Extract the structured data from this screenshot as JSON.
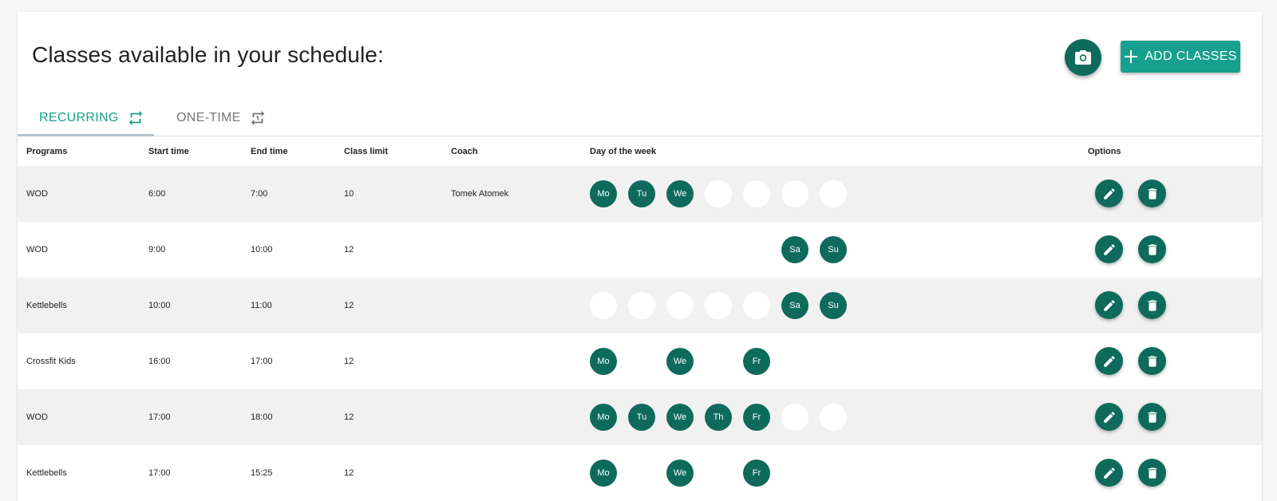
{
  "header": {
    "title": "Classes available in your schedule:",
    "camera_icon": "camera-icon",
    "add_label": "ADD CLASSES",
    "add_icon": "plus-icon"
  },
  "tabs": [
    {
      "label": "RECURRING",
      "icon": "repeat-icon",
      "active": true
    },
    {
      "label": "ONE-TIME",
      "icon": "repeat-once-icon",
      "active": false
    }
  ],
  "columns": {
    "programs": "Programs",
    "start": "Start time",
    "end": "End time",
    "limit": "Class limit",
    "coach": "Coach",
    "day": "Day of the week",
    "options": "Options"
  },
  "day_slots": [
    "Mo",
    "Tu",
    "We",
    "Th",
    "Fr",
    "Sa",
    "Su"
  ],
  "rows": [
    {
      "program": "WOD",
      "start": "6:00",
      "end": "7:00",
      "limit": "10",
      "coach": "Tomek Atomek",
      "days": [
        "on",
        "on",
        "on",
        "off",
        "off",
        "off",
        "off"
      ]
    },
    {
      "program": "WOD",
      "start": "9:00",
      "end": "10:00",
      "limit": "12",
      "coach": "",
      "days": [
        "none",
        "none",
        "none",
        "none",
        "none",
        "on",
        "on"
      ]
    },
    {
      "program": "Kettlebells",
      "start": "10:00",
      "end": "11:00",
      "limit": "12",
      "coach": "",
      "days": [
        "off",
        "off",
        "off",
        "off",
        "off",
        "on",
        "on"
      ]
    },
    {
      "program": "Crossfit Kids",
      "start": "16:00",
      "end": "17:00",
      "limit": "12",
      "coach": "",
      "days": [
        "on",
        "none",
        "on",
        "none",
        "on",
        "none",
        "none"
      ]
    },
    {
      "program": "WOD",
      "start": "17:00",
      "end": "18:00",
      "limit": "12",
      "coach": "",
      "days": [
        "on",
        "on",
        "on",
        "on",
        "on",
        "off",
        "off"
      ]
    },
    {
      "program": "Kettlebells",
      "start": "17:00",
      "end": "15:25",
      "limit": "12",
      "coach": "",
      "days": [
        "on",
        "none",
        "on",
        "none",
        "on",
        "none",
        "none"
      ]
    }
  ],
  "row_options": {
    "edit_icon": "pencil-icon",
    "delete_icon": "trash-icon"
  },
  "colors": {
    "primary_dark": "#0e6b5c",
    "primary": "#16a08d",
    "row_shade": "#f1f1f1",
    "inactive_tab": "#777777"
  }
}
